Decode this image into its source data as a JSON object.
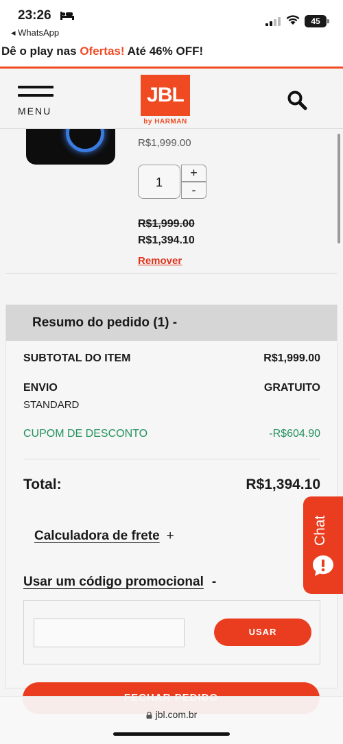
{
  "status_bar": {
    "time": "23:26",
    "back_app": "◂ WhatsApp",
    "battery": "45"
  },
  "promo_banner": {
    "prefix": "Dê o play nas ",
    "highlight": "Ofertas!",
    "suffix": " Até 46% OFF!",
    "accent_color": "#f04a23"
  },
  "header": {
    "menu_label": "MENU",
    "logo_text": "JBL",
    "logo_sub": "by HARMAN"
  },
  "product": {
    "unit_price": "R$1,999.00",
    "quantity": "1",
    "qty_plus": "+",
    "qty_minus": "-",
    "old_price": "R$1,999.00",
    "new_price": "R$1,394.10",
    "remove_label": "Remover"
  },
  "summary": {
    "title": "Resumo do pedido (1) -",
    "subtotal_label": "SUBTOTAL DO ITEM",
    "subtotal_value": "R$1,999.00",
    "shipping_label": "ENVIO",
    "shipping_value": "GRATUITO",
    "shipping_method": "STANDARD",
    "discount_label": "CUPOM DE DESCONTO",
    "discount_value": "-R$604.90",
    "discount_color": "#22915c",
    "total_label": "Total:",
    "total_value": "R$1,394.10",
    "calc_label": "Calculadora de frete",
    "calc_toggle": "+",
    "promo_label": "Usar um código promocional",
    "promo_toggle": "-",
    "apply_button": "USAR",
    "checkout_button": "FECHAR PEDIDO"
  },
  "chat": {
    "label": "Chat"
  },
  "browser": {
    "url": "jbl.com.br"
  }
}
